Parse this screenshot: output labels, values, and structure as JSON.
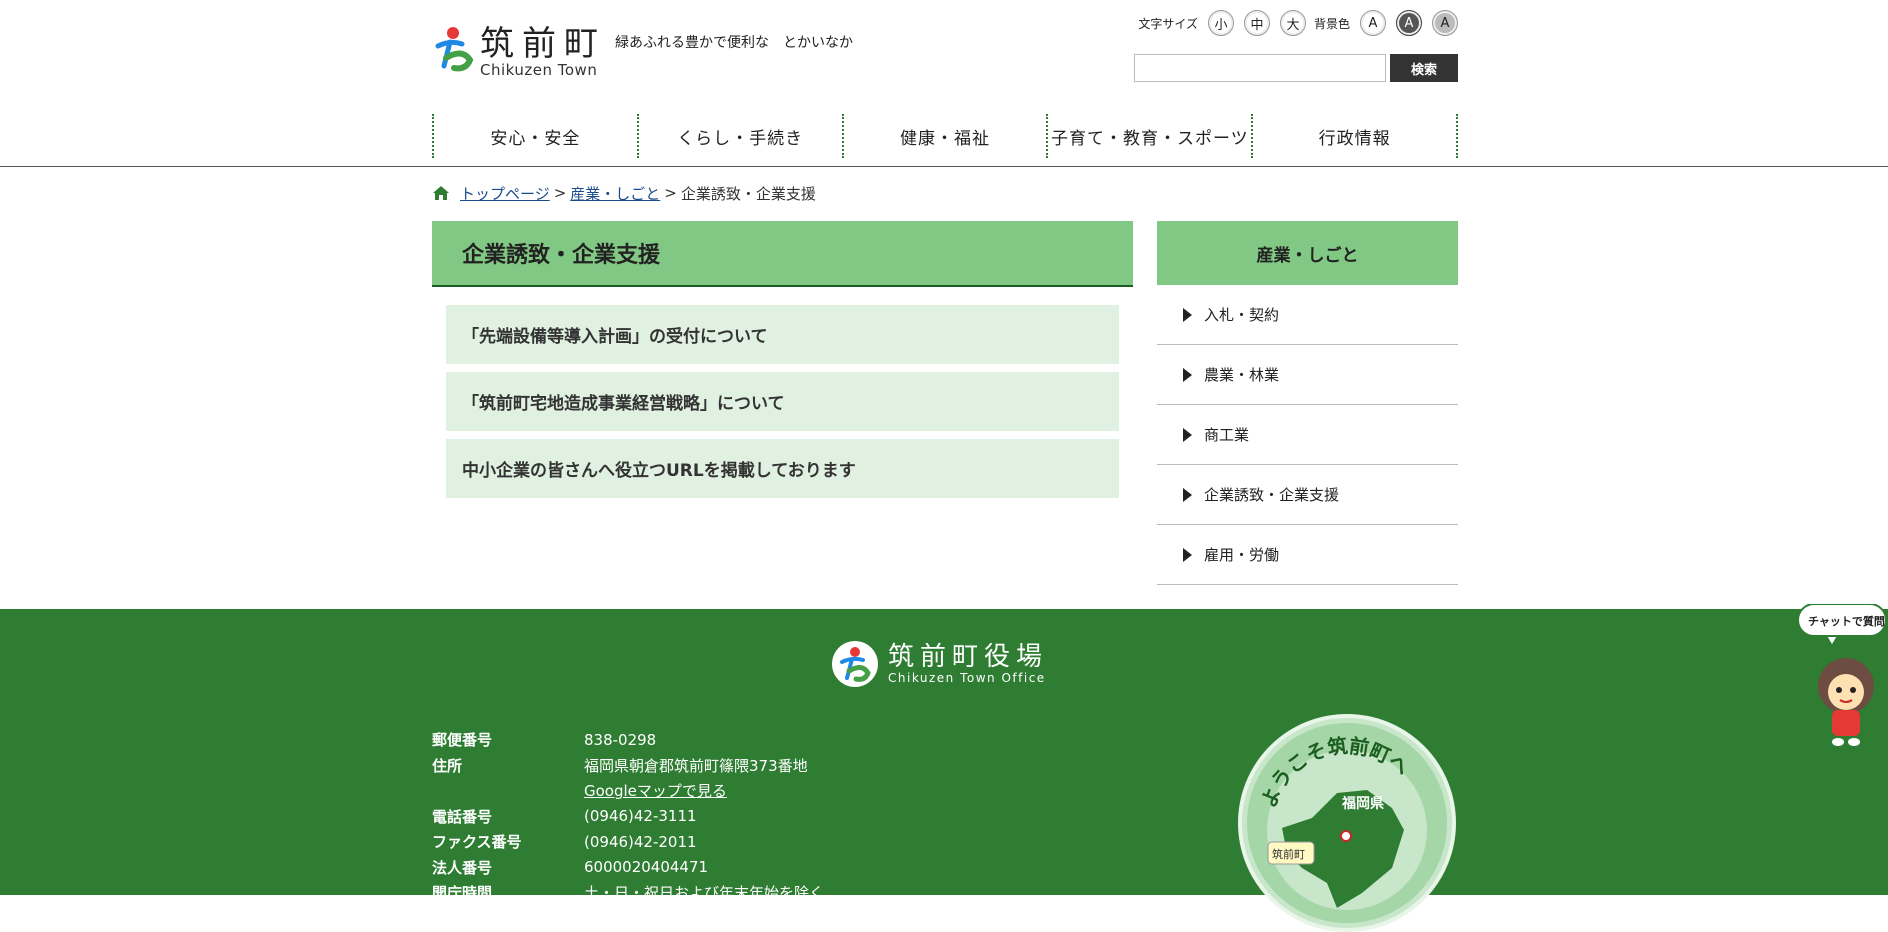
{
  "header": {
    "logo_jp": "筑前町",
    "logo_en": "Chikuzen Town",
    "tagline": "緑あふれる豊かで便利な　とかいなか",
    "font_size_label": "文字サイズ",
    "font_sizes": [
      "小",
      "中",
      "大"
    ],
    "bg_color_label": "背景色",
    "bg_options": [
      "A",
      "A",
      "A"
    ],
    "search_placeholder": "",
    "search_button": "検索"
  },
  "gnav": [
    "安心・安全",
    "くらし・手続き",
    "健康・福祉",
    "子育て・教育・スポーツ",
    "行政情報"
  ],
  "breadcrumb": {
    "home": "トップページ",
    "sep": ">",
    "parent": "産業・しごと",
    "current": "企業誘致・企業支援"
  },
  "main": {
    "title": "企業誘致・企業支援",
    "links": [
      "「先端設備等導入計画」の受付について",
      "「筑前町宅地造成事業経営戦略」について",
      "中小企業の皆さんへ役立つURLを掲載しております"
    ]
  },
  "side": {
    "title": "産業・しごと",
    "items": [
      "入札・契約",
      "農業・林業",
      "商工業",
      "企業誘致・企業支援",
      "雇用・労働"
    ]
  },
  "footer": {
    "logo_jp": "筑前町役場",
    "logo_en": "Chikuzen Town Office",
    "rows": [
      {
        "k": "郵便番号",
        "v": "838-0298"
      },
      {
        "k": "住所",
        "v": "福岡県朝倉郡筑前町篠隈373番地"
      },
      {
        "k": "",
        "v": "Googleマップで見る"
      },
      {
        "k": "電話番号",
        "v": "(0946)42-3111"
      },
      {
        "k": "ファクス番号",
        "v": "(0946)42-2011"
      },
      {
        "k": "法人番号",
        "v": "6000020404471"
      },
      {
        "k": "開庁時間",
        "v": "土・日・祝日および年末年始を除く"
      }
    ],
    "welcome": "ようこそ筑前町へ",
    "welcome_pref": "福岡県",
    "welcome_town": "筑前町",
    "chat": "チャットで質問"
  }
}
